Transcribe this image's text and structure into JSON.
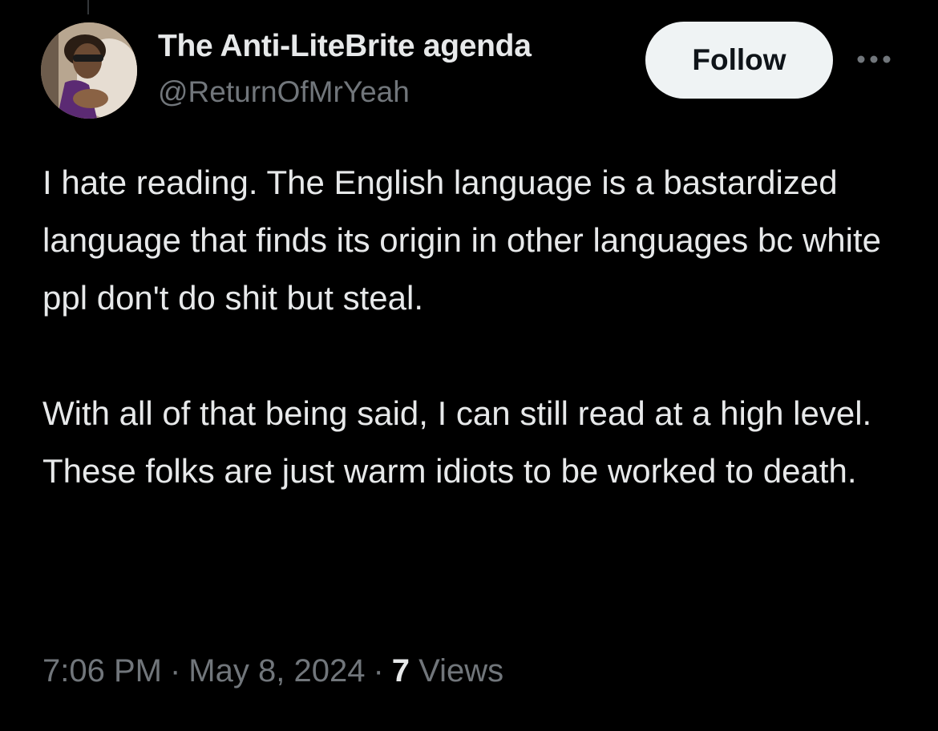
{
  "author": {
    "display_name": "The Anti-LiteBrite agenda",
    "handle": "@ReturnOfMrYeah",
    "avatar_icon": "user-avatar"
  },
  "actions": {
    "follow_label": "Follow",
    "more_icon": "more-horizontal-icon"
  },
  "tweet": {
    "paragraphs": [
      "I hate reading. The English language is a bastardized language that finds its origin in other languages bc white ppl don't do shit but steal.",
      "With all of that being said, I can still read at a high level. These folks are just warm idiots to be worked to death."
    ]
  },
  "meta": {
    "time": "7:06 PM",
    "separator": "·",
    "date": "May 8, 2024",
    "views_count": "7",
    "views_label": "Views"
  },
  "colors": {
    "background": "#000000",
    "primary_text": "#e7e9ea",
    "secondary_text": "#71767b",
    "follow_bg": "#eff3f4",
    "follow_text": "#0f1419"
  }
}
